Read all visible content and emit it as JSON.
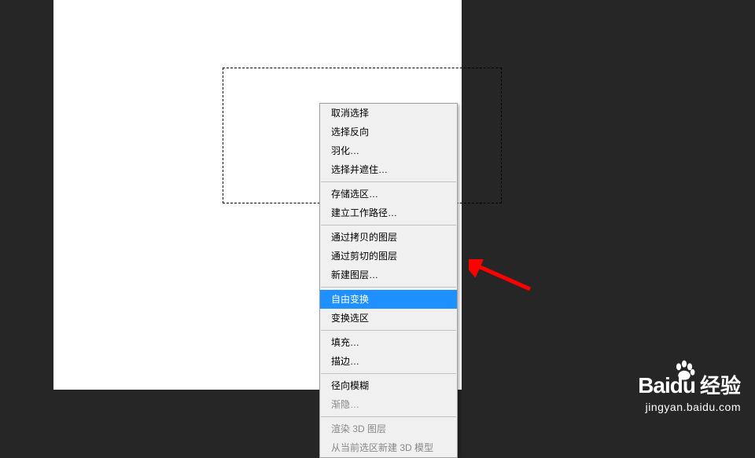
{
  "menu": {
    "items": [
      {
        "label": "取消选择",
        "enabled": true
      },
      {
        "label": "选择反向",
        "enabled": true
      },
      {
        "label": "羽化…",
        "enabled": true
      },
      {
        "label": "选择并遮住…",
        "enabled": true
      },
      {
        "separator": true
      },
      {
        "label": "存储选区…",
        "enabled": true
      },
      {
        "label": "建立工作路径…",
        "enabled": true
      },
      {
        "separator": true
      },
      {
        "label": "通过拷贝的图层",
        "enabled": true
      },
      {
        "label": "通过剪切的图层",
        "enabled": true
      },
      {
        "label": "新建图层…",
        "enabled": true
      },
      {
        "separator": true
      },
      {
        "label": "自由变换",
        "enabled": true,
        "highlighted": true
      },
      {
        "label": "变换选区",
        "enabled": true
      },
      {
        "separator": true
      },
      {
        "label": "填充…",
        "enabled": true
      },
      {
        "label": "描边…",
        "enabled": true
      },
      {
        "separator": true
      },
      {
        "label": "径向模糊",
        "enabled": true
      },
      {
        "label": "渐隐…",
        "enabled": false
      },
      {
        "separator": true
      },
      {
        "label": "渲染 3D 图层",
        "enabled": false
      },
      {
        "label": "从当前选区新建 3D 模型",
        "enabled": false
      }
    ]
  },
  "watermark": {
    "brand": "Bai",
    "brand_suffix": "du",
    "jingyan": "经验",
    "url": "jingyan.baidu.com"
  },
  "annotation": {
    "arrow_color": "#ff0000"
  }
}
